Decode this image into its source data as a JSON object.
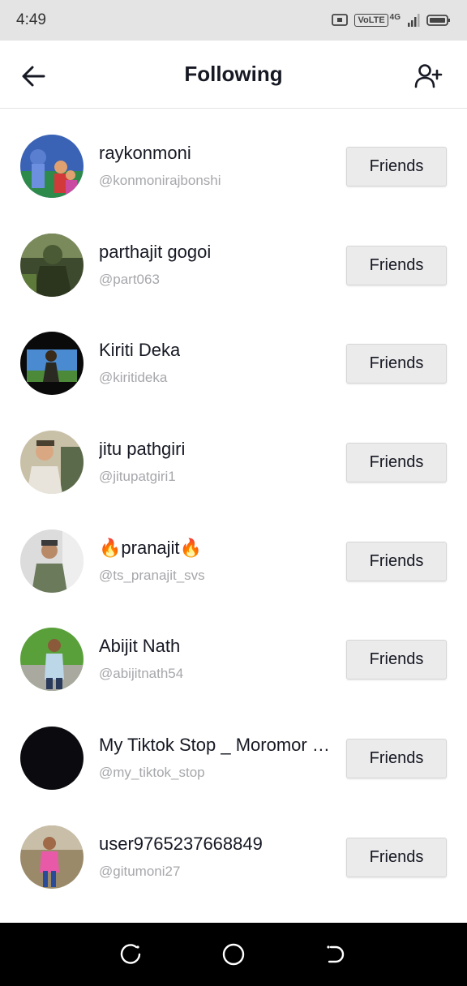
{
  "status_bar": {
    "time": "4:49",
    "network": "VoLTE",
    "network_gen": "4G"
  },
  "header": {
    "title": "Following"
  },
  "colors": {
    "button_bg": "#ebebeb",
    "handle_text": "#a6a7ab",
    "primary_text": "#161823"
  },
  "users": [
    {
      "name": "raykonmoni",
      "handle": "@konmonirajbonshi",
      "button": "Friends"
    },
    {
      "name": "parthajit gogoi",
      "handle": "@part063",
      "button": "Friends"
    },
    {
      "name": "Kiriti Deka",
      "handle": "@kiritideka",
      "button": "Friends"
    },
    {
      "name": "jitu pathgiri",
      "handle": "@jitupatgiri1",
      "button": "Friends"
    },
    {
      "name": "🔥pranajit🔥",
      "handle": "@ts_pranajit_svs",
      "button": "Friends"
    },
    {
      "name": "Abijit Nath",
      "handle": "@abijitnath54",
      "button": "Friends"
    },
    {
      "name": "My Tiktok Stop _ Moromor Jaan",
      "handle": "@my_tiktok_stop",
      "button": "Friends"
    },
    {
      "name": "user9765237668849",
      "handle": "@gitumoni27",
      "button": "Friends"
    }
  ]
}
